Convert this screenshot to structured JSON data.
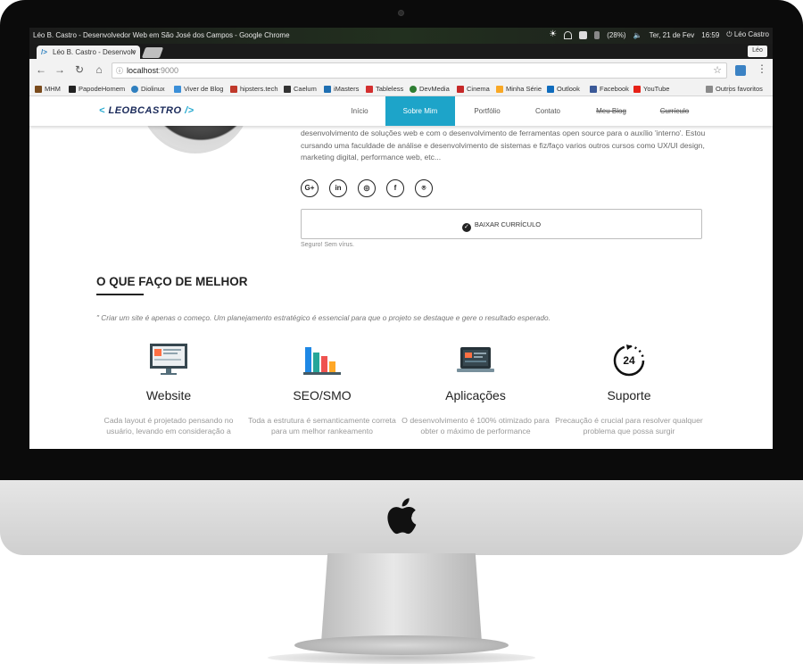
{
  "os_bar": {
    "window_title": "Léo B. Castro - Desenvolvedor Web em São José dos Campos - Google Chrome",
    "battery": "(28%)",
    "datetime": "Ter, 21 de Fev",
    "time": "16:59",
    "user": "Léo Castro"
  },
  "browser": {
    "tab_title": "Léo B. Castro - Desenvolv",
    "profile_label": "Léo",
    "url_host": "localhost",
    "url_port": ":9000",
    "bookmarks": [
      {
        "label": "MHM",
        "color": "#7a4b1c"
      },
      {
        "label": "PapodeHomem",
        "color": "#222222"
      },
      {
        "label": "Diolinux",
        "color": "#2f7fbf"
      },
      {
        "label": "Viver de Blog",
        "color": "#3b8fd8"
      },
      {
        "label": "hipsters.tech",
        "color": "#c0392b"
      },
      {
        "label": "Caelum",
        "color": "#333333"
      },
      {
        "label": "iMasters",
        "color": "#1f6fb2"
      },
      {
        "label": "Tableless",
        "color": "#d32f2f"
      },
      {
        "label": "DevMedia",
        "color": "#2e7d32"
      },
      {
        "label": "Cinema",
        "color": "#c62828"
      },
      {
        "label": "Minha Série",
        "color": "#f9a825"
      },
      {
        "label": "Outlook",
        "color": "#0f6cbd"
      },
      {
        "label": "Facebook",
        "color": "#3b5998"
      },
      {
        "label": "YouTube",
        "color": "#e62117"
      }
    ],
    "other_bookmarks": "Outros favoritos"
  },
  "site": {
    "logo_open": "<",
    "logo_text": "LEOBCASTRO",
    "logo_close": "/>",
    "nav": [
      {
        "label": "Início"
      },
      {
        "label": "Sobre Mim"
      },
      {
        "label": "Portfólio"
      },
      {
        "label": "Contato"
      },
      {
        "label": "Meu Blog"
      },
      {
        "label": "Currículo"
      }
    ],
    "accent_color": "#1da4c9",
    "bio_text": "desenvolvimento de soluções web e com o desenvolvimento de ferramentas open source para o auxílio 'interno'. Estou cursando uma faculdade de análise e desenvolvimento de sistemas e fiz/faço varios outros cursos como UX/UI design, marketing digital, performance web, etc...",
    "social": [
      {
        "icon": "google-plus-icon",
        "glyph": "G+"
      },
      {
        "icon": "linkedin-icon",
        "glyph": "in"
      },
      {
        "icon": "instagram-icon",
        "glyph": "◎"
      },
      {
        "icon": "facebook-icon",
        "glyph": "f"
      },
      {
        "icon": "github-icon",
        "glyph": "⌾"
      }
    ],
    "download_button": "BAIXAR CURRÍCULO",
    "safe_note": "Seguro! Sem vírus.",
    "section_title": "O QUE FAÇO DE MELHOR",
    "section_quote": "\" Criar um site é apenas o começo. Um planejamento estratégico é essencial para que o projeto se destaque e gere o resultado esperado.",
    "services": [
      {
        "title": "Website",
        "icon": "website-layout-icon",
        "desc": "Cada layout é projetado pensando no usuário, levando em consideração a"
      },
      {
        "title": "SEO/SMO",
        "icon": "seo-chart-icon",
        "desc": "Toda a estrutura é semanticamente correta para um melhor rankeamento"
      },
      {
        "title": "Aplicações",
        "icon": "laptop-app-icon",
        "desc": "O desenvolvimento é 100% otimizado para obter o máximo de performance"
      },
      {
        "title": "Suporte",
        "icon": "support-24h-icon",
        "desc": "Precaução é crucial para resolver qualquer problema que possa surgir"
      }
    ]
  }
}
